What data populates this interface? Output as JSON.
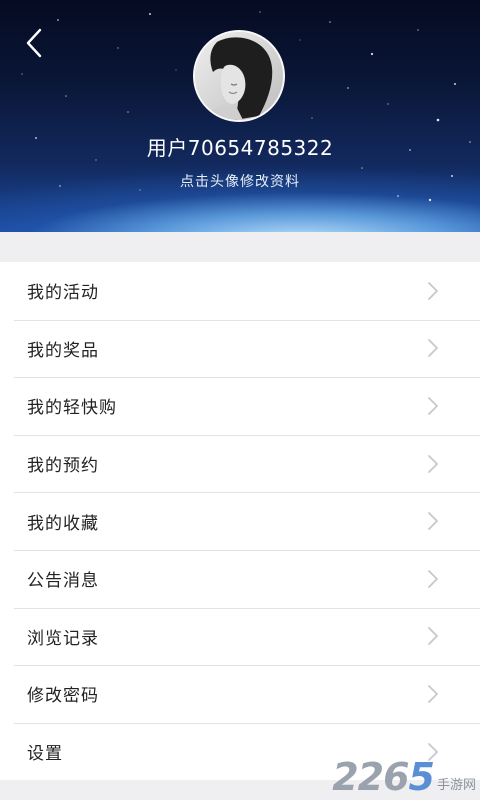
{
  "header": {
    "back_icon": "chevron-left-icon",
    "avatar_icon": "user-avatar-photo",
    "username": "用户70654785322",
    "edit_hint": "点击头像修改资料"
  },
  "menu": {
    "items": [
      {
        "label": "我的活动"
      },
      {
        "label": "我的奖品"
      },
      {
        "label": "我的轻快购"
      },
      {
        "label": "我的预约"
      },
      {
        "label": "我的收藏"
      },
      {
        "label": "公告消息"
      },
      {
        "label": "浏览记录"
      },
      {
        "label": "修改密码"
      },
      {
        "label": "设置"
      }
    ],
    "chevron_icon": "chevron-right-icon"
  },
  "watermark": {
    "number_part1": "22",
    "number_part2": "6",
    "number_part3": "5",
    "text": "手游网"
  },
  "colors": {
    "header_top": "#050b22",
    "header_bottom": "#1b4aa0",
    "background": "#efeff1",
    "menu_bg": "#ffffff",
    "text": "#222222",
    "chevron": "#c8c8cc"
  }
}
